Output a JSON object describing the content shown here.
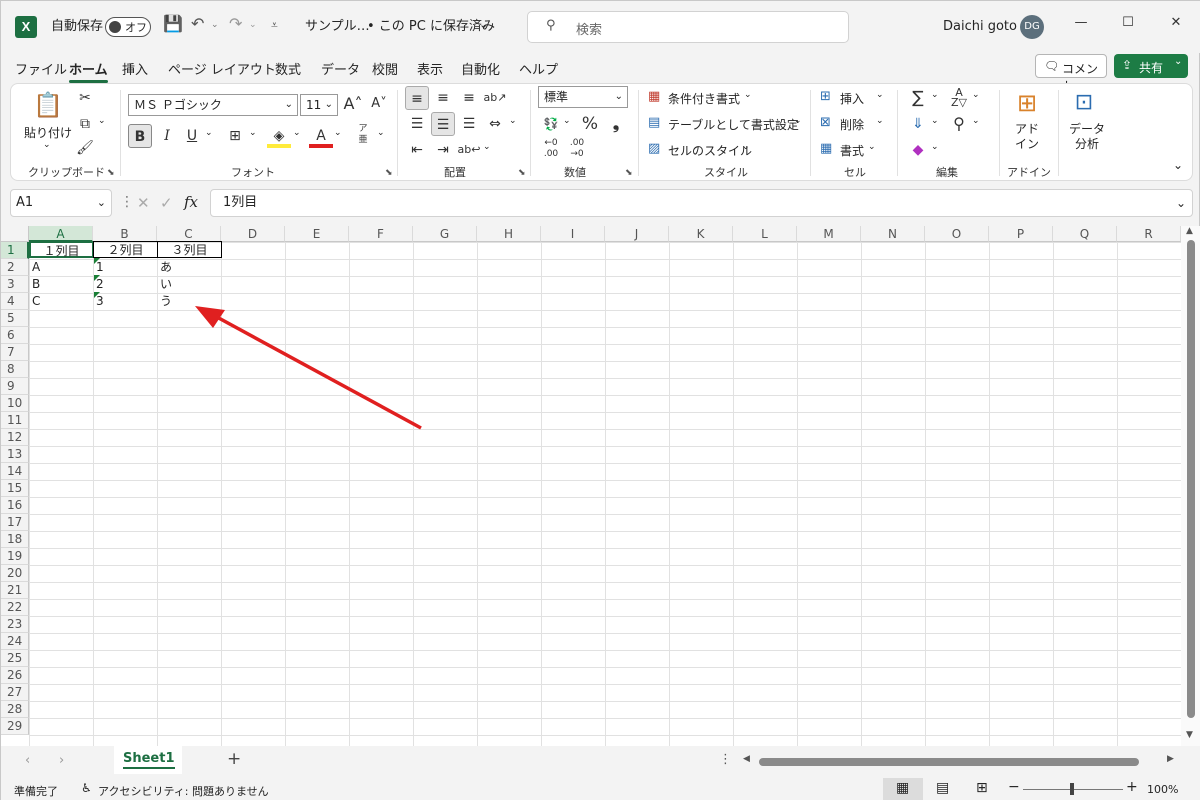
{
  "app": {
    "logo": "X",
    "autosave_label": "自動保存",
    "autosave_state": "オフ",
    "filename": "サンプル…",
    "save_status": "• この PC に保存済み",
    "search_placeholder": "検索",
    "user_name": "Daichi goto",
    "user_initials": "DG"
  },
  "tabs": [
    "ファイル",
    "ホーム",
    "挿入",
    "ページ レイアウト",
    "数式",
    "データ",
    "校閲",
    "表示",
    "自動化",
    "ヘルプ"
  ],
  "actions": {
    "comment": "コメント",
    "share": "共有"
  },
  "ribbon": {
    "clipboard": {
      "paste": "貼り付け",
      "label": "クリップボード"
    },
    "font": {
      "name": "ＭＳ Ｐゴシック",
      "size": "11",
      "label": "フォント",
      "bold": "B",
      "italic": "I",
      "underline": "U"
    },
    "alignment": {
      "label": "配置"
    },
    "number": {
      "format": "標準",
      "label": "数値"
    },
    "style": {
      "conditional": "条件付き書式",
      "table": "テーブルとして書式設定",
      "cell_style": "セルのスタイル",
      "label": "スタイル"
    },
    "cells": {
      "insert": "挿入",
      "delete": "削除",
      "format": "書式",
      "label": "セル"
    },
    "edit": {
      "label": "編集"
    },
    "addin": {
      "addin_btn": "アド\nイン",
      "label": "アドイン"
    },
    "analysis": {
      "btn": "データ\n分析"
    }
  },
  "formula": {
    "cell_ref": "A1",
    "fx": "fx",
    "value": "1列目"
  },
  "columns": [
    "A",
    "B",
    "C",
    "D",
    "E",
    "F",
    "G",
    "H",
    "I",
    "J",
    "K",
    "L",
    "M",
    "N",
    "O",
    "P",
    "Q",
    "R"
  ],
  "rows": [
    "1",
    "2",
    "3",
    "4",
    "5",
    "6",
    "7",
    "8",
    "9",
    "10",
    "11",
    "12",
    "13",
    "14",
    "15",
    "16",
    "17",
    "18",
    "19",
    "20",
    "21",
    "22",
    "23",
    "24",
    "25",
    "26",
    "27",
    "28",
    "29"
  ],
  "cells": {
    "header": [
      "１列目",
      "２列目",
      "３列目"
    ],
    "data": [
      [
        "A",
        "1",
        "あ"
      ],
      [
        "B",
        "2",
        "い"
      ],
      [
        "C",
        "3",
        "う"
      ]
    ]
  },
  "sheets": {
    "active": "Sheet1",
    "add": "+"
  },
  "status": {
    "ready": "準備完了",
    "accessibility": "アクセシビリティ: 問題ありません",
    "zoom": "100%"
  },
  "colors": {
    "accent": "#1d6f42",
    "arrow": "#e02020"
  }
}
